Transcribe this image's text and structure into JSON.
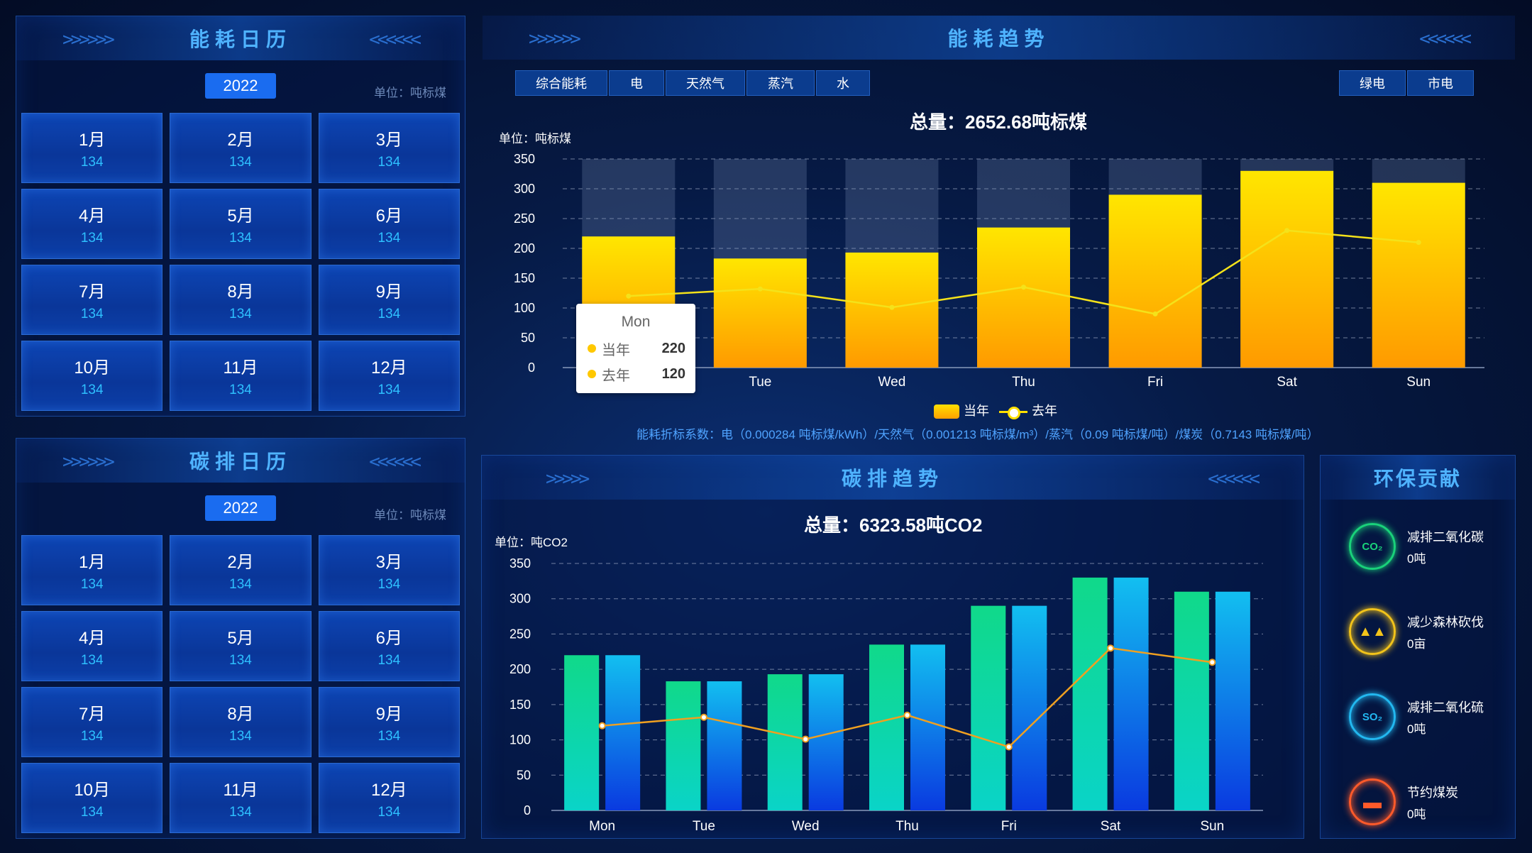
{
  "energy_calendar": {
    "title": "能耗日历",
    "year": "2022",
    "unit": "单位：吨标煤",
    "months": [
      {
        "label": "1月",
        "value": "134"
      },
      {
        "label": "2月",
        "value": "134"
      },
      {
        "label": "3月",
        "value": "134"
      },
      {
        "label": "4月",
        "value": "134"
      },
      {
        "label": "5月",
        "value": "134"
      },
      {
        "label": "6月",
        "value": "134"
      },
      {
        "label": "7月",
        "value": "134"
      },
      {
        "label": "8月",
        "value": "134"
      },
      {
        "label": "9月",
        "value": "134"
      },
      {
        "label": "10月",
        "value": "134"
      },
      {
        "label": "11月",
        "value": "134"
      },
      {
        "label": "12月",
        "value": "134"
      }
    ]
  },
  "carbon_calendar": {
    "title": "碳排日历",
    "year": "2022",
    "unit": "单位：吨标煤",
    "months": [
      {
        "label": "1月",
        "value": "134"
      },
      {
        "label": "2月",
        "value": "134"
      },
      {
        "label": "3月",
        "value": "134"
      },
      {
        "label": "4月",
        "value": "134"
      },
      {
        "label": "5月",
        "value": "134"
      },
      {
        "label": "6月",
        "value": "134"
      },
      {
        "label": "7月",
        "value": "134"
      },
      {
        "label": "8月",
        "value": "134"
      },
      {
        "label": "9月",
        "value": "134"
      },
      {
        "label": "10月",
        "value": "134"
      },
      {
        "label": "11月",
        "value": "134"
      },
      {
        "label": "12月",
        "value": "134"
      }
    ]
  },
  "energy_trend": {
    "title": "能耗趋势",
    "tabs": [
      "综合能耗",
      "电",
      "天然气",
      "蒸汽",
      "水"
    ],
    "tabs_right": [
      "绿电",
      "市电"
    ],
    "total": "总量：2652.68吨标煤",
    "unit": "单位：吨标煤",
    "legend_current": "当年",
    "legend_last": "去年",
    "footnote": "能耗折标系数：电（0.000284 吨标煤/kWh）/天然气（0.001213 吨标煤/m³）/蒸汽（0.09 吨标煤/吨）/煤炭（0.7143 吨标煤/吨）",
    "tooltip": {
      "title": "Mon",
      "row1_label": "当年",
      "row1_value": "220",
      "row2_label": "去年",
      "row2_value": "120"
    }
  },
  "carbon_trend": {
    "title": "碳排趋势",
    "total": "总量：6323.58吨CO2",
    "unit": "单位：吨CO2"
  },
  "eco": {
    "title": "环保贡献",
    "items": [
      {
        "label": "减排二氧化碳",
        "value": "0吨",
        "icon": "co2-cloud-icon",
        "badge": "CO₂",
        "color": "#19d27a"
      },
      {
        "label": "减少森林砍伐",
        "value": "0亩",
        "icon": "tree-icon",
        "badge": "",
        "color": "#f2c31a"
      },
      {
        "label": "减排二氧化硫",
        "value": "0吨",
        "icon": "so2-cloud-icon",
        "badge": "SO₂",
        "color": "#22b8f0"
      },
      {
        "label": "节约煤炭",
        "value": "0吨",
        "icon": "coal-cart-icon",
        "badge": "",
        "color": "#ff5a2a"
      }
    ]
  },
  "chart_data": [
    {
      "type": "bar",
      "title": "总量：2652.68吨标煤",
      "ylabel": "单位：吨标煤",
      "categories": [
        "Mon",
        "Tue",
        "Wed",
        "Thu",
        "Fri",
        "Sat",
        "Sun"
      ],
      "ylim": [
        0,
        350
      ],
      "yticks": [
        0,
        50,
        100,
        150,
        200,
        250,
        300,
        350
      ],
      "series": [
        {
          "name": "当年",
          "kind": "bar",
          "values": [
            220,
            183,
            193,
            235,
            290,
            330,
            310
          ]
        },
        {
          "name": "去年",
          "kind": "line",
          "values": [
            120,
            132,
            101,
            135,
            90,
            230,
            210
          ]
        }
      ],
      "legend": "bottom-center",
      "grid": true
    },
    {
      "type": "bar",
      "title": "总量：6323.58吨CO2",
      "ylabel": "单位：吨CO2",
      "categories": [
        "Mon",
        "Tue",
        "Wed",
        "Thu",
        "Fri",
        "Sat",
        "Sun"
      ],
      "ylim": [
        0,
        350
      ],
      "yticks": [
        0,
        50,
        100,
        150,
        200,
        250,
        300,
        350
      ],
      "series": [
        {
          "kind": "bar",
          "values": [
            220,
            183,
            193,
            235,
            290,
            330,
            310
          ],
          "color": "#10d9a0"
        },
        {
          "kind": "bar",
          "values": [
            220,
            183,
            193,
            235,
            290,
            330,
            310
          ],
          "color": "#14b8f0"
        },
        {
          "kind": "line",
          "values": [
            120,
            132,
            101,
            135,
            90,
            230,
            210
          ],
          "color": "#f0a020"
        }
      ],
      "grid": true
    }
  ]
}
